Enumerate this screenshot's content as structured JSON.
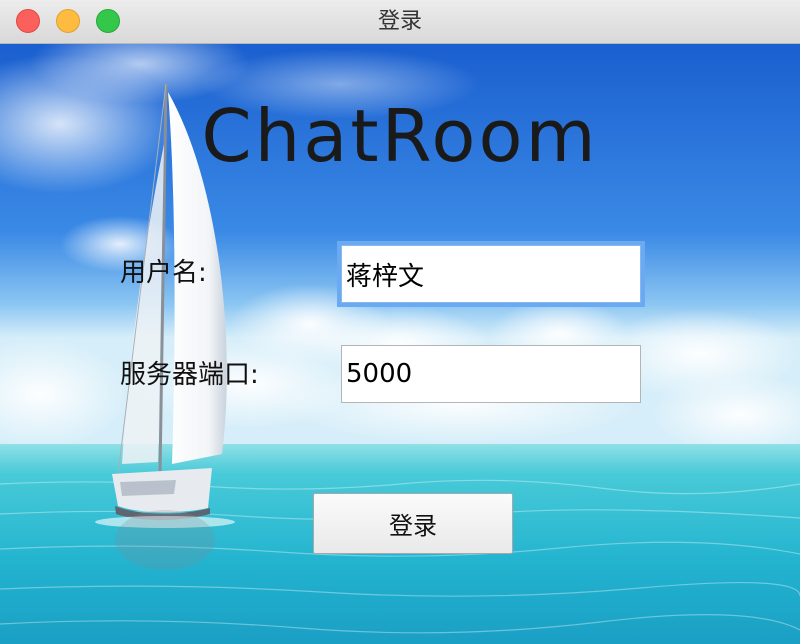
{
  "window": {
    "title": "登录",
    "controls": [
      "close",
      "minimize",
      "zoom"
    ]
  },
  "logo": {
    "text": "ChatRoom"
  },
  "form": {
    "username": {
      "label": "用户名:",
      "value": "蒋梓文"
    },
    "port": {
      "label": "服务器端口:",
      "value": "5000"
    },
    "submit_label": "登录"
  },
  "colors": {
    "close": "#fc605c",
    "minimize": "#fdbc40",
    "zoom": "#34c84a",
    "focus_ring": "#6aaaf3",
    "sky": "#1d6fd6",
    "sea": "#33c6d6"
  },
  "background": {
    "scene": "sky-with-clouds-and-sailboat-on-turquoise-sea"
  }
}
